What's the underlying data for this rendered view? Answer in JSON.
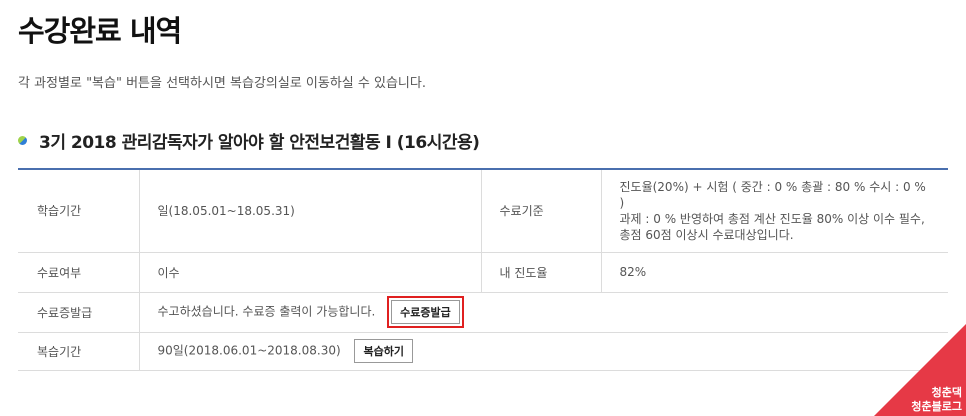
{
  "page": {
    "title": "수강완료 내역",
    "description": "각 과정별로 \"복습\" 버튼을 선택하시면 복습강의실로 이동하실 수 있습니다."
  },
  "course": {
    "title": "3기 2018 관리감독자가 알아야 할 안전보건활동 I (16시간용)"
  },
  "table": {
    "row1": {
      "label": "학습기간",
      "value": "일(18.05.01~18.05.31)",
      "label2": "수료기준",
      "value2_line1": "진도율(20%) + 시험 ( 중간 : 0 % 총괄 : 80 % 수시 : 0 % )",
      "value2_line2": "과제 : 0 % 반영하여 총점 계산 진도율 80% 이상 이수 필수,",
      "value2_line3": "총점 60점 이상시 수료대상입니다."
    },
    "row2": {
      "label": "수료여부",
      "value": "이수",
      "label2": "내 진도율",
      "value2": "82%"
    },
    "row3": {
      "label": "수료증발급",
      "value": "수고하셨습니다. 수료증 출력이 가능합니다.",
      "button": "수료증발급"
    },
    "row4": {
      "label": "복습기간",
      "value": "90일(2018.06.01~2018.08.30)",
      "button": "복습하기"
    }
  },
  "corner": {
    "line1": "청춘댁",
    "line2": "청춘블로그",
    "color": "#e63946"
  },
  "colors": {
    "table_border": "#4a6fae",
    "highlight": "#e02020"
  }
}
